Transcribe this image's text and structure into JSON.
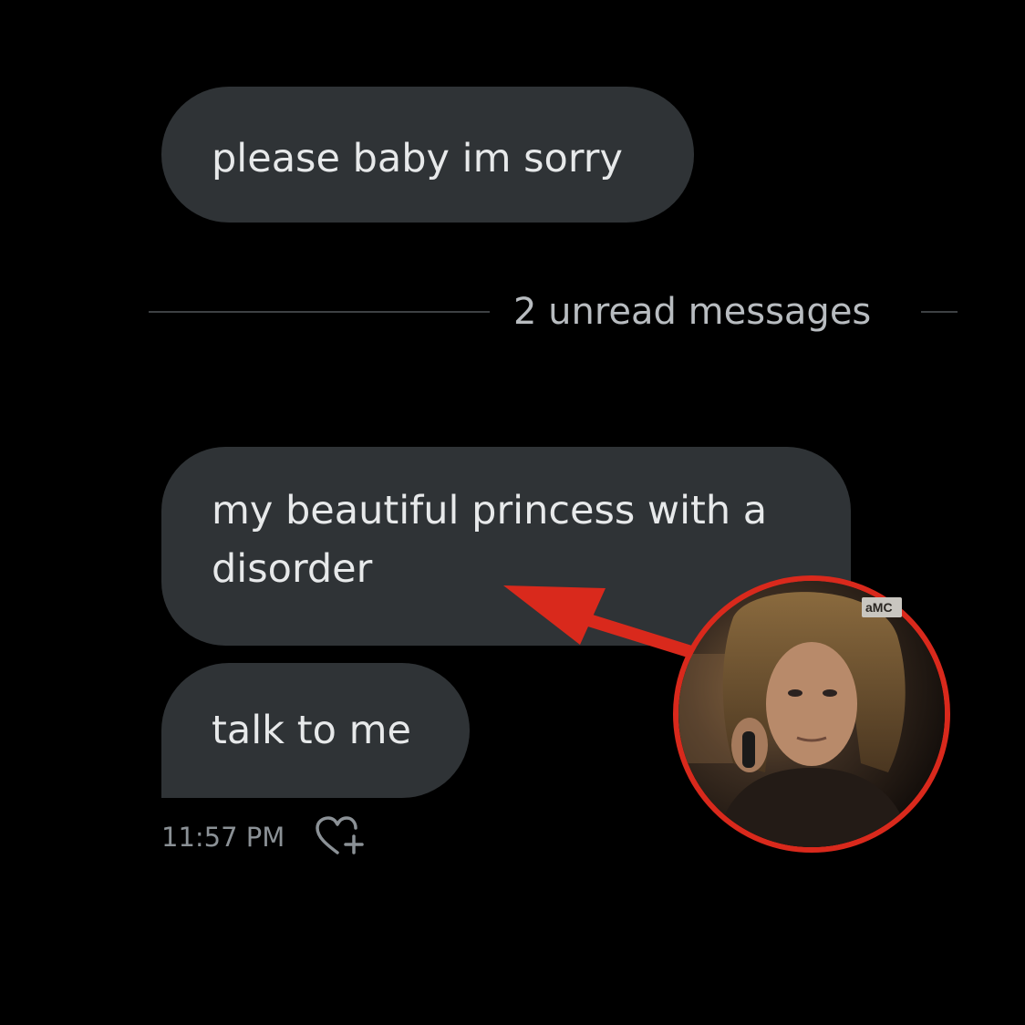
{
  "messages": [
    {
      "text": "please baby im sorry"
    },
    {
      "text": "my beautiful princess with a disorder"
    },
    {
      "text": "talk to me"
    }
  ],
  "divider": {
    "label": "2 unread messages"
  },
  "meta": {
    "timestamp": "11:57 PM",
    "reaction_icon": "heart-plus-icon"
  },
  "overlay": {
    "watermark": "aMC",
    "accent_color": "#d9291c",
    "bubble_color": "#2f3336"
  }
}
